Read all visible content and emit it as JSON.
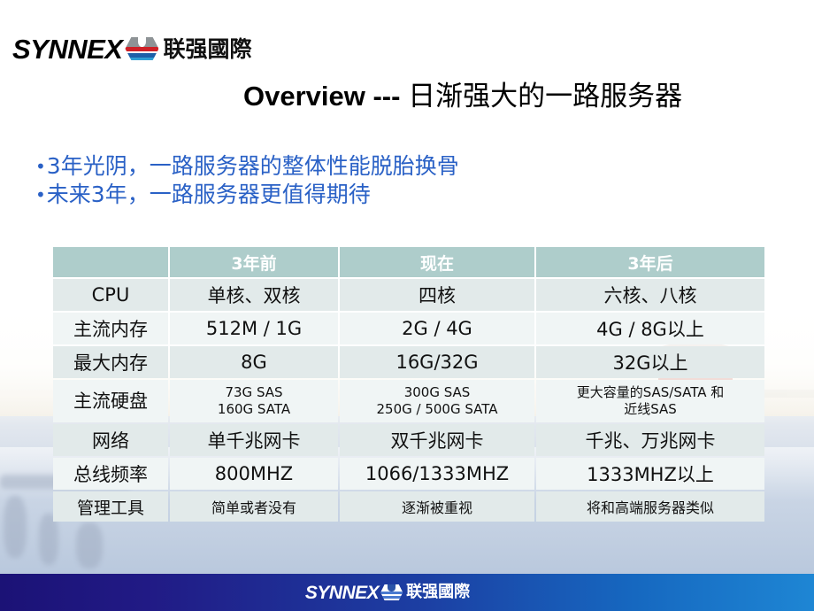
{
  "brand": {
    "wordmark": "SYNNEX",
    "cjk": "联强國際",
    "logo_icon": "synnex-hexagon-icon"
  },
  "title": {
    "latin": "Overview ---",
    "cjk": "日渐强大的一路服务器"
  },
  "bullets": [
    {
      "dot": "•",
      "text": "3年光阴，一路服务器的整体性能脱胎换骨"
    },
    {
      "dot": "•",
      "text": "未来3年，一路服务器更值得期待"
    }
  ],
  "table": {
    "headers": [
      "",
      "3年前",
      "现在",
      "3年后"
    ],
    "rows": [
      {
        "label": "CPU",
        "past": "单核、双核",
        "now": "四核",
        "future": "六核、八核"
      },
      {
        "label": "主流内存",
        "past": "512M / 1G",
        "now": "2G / 4G",
        "future": "4G / 8G以上"
      },
      {
        "label": "最大内存",
        "past": "8G",
        "now": "16G/32G",
        "future": "32G以上"
      },
      {
        "label": "主流硬盘",
        "past_line1": "73G SAS",
        "past_line2": "160G SATA",
        "now_line1": "300G SAS",
        "now_line2": "250G / 500G SATA",
        "future_line1": "更大容量的SAS/SATA 和",
        "future_line2": "近线SAS"
      },
      {
        "label": "网络",
        "past": "单千兆网卡",
        "now": "双千兆网卡",
        "future": "千兆、万兆网卡"
      },
      {
        "label": "总线频率",
        "past": "800MHZ",
        "now": "1066/1333MHZ",
        "future": "1333MHZ以上"
      },
      {
        "label": "管理工具",
        "past": "简单或者没有",
        "now": "逐渐被重视",
        "future": "将和高端服务器类似"
      }
    ]
  },
  "footer": {
    "wordmark": "SYNNEX",
    "cjk": "联强國際"
  },
  "colors": {
    "table_header_bg": "#aecdcb",
    "row_odd_bg": "#e2eaea",
    "row_even_bg": "#f0f5f5",
    "bullet_text": "#2a61c6",
    "footer_gradient_start": "#1b1276",
    "footer_gradient_end": "#1e86d4",
    "logo_red": "#cf2027",
    "logo_blue": "#1d5fa8",
    "logo_gray": "#8e9396"
  }
}
